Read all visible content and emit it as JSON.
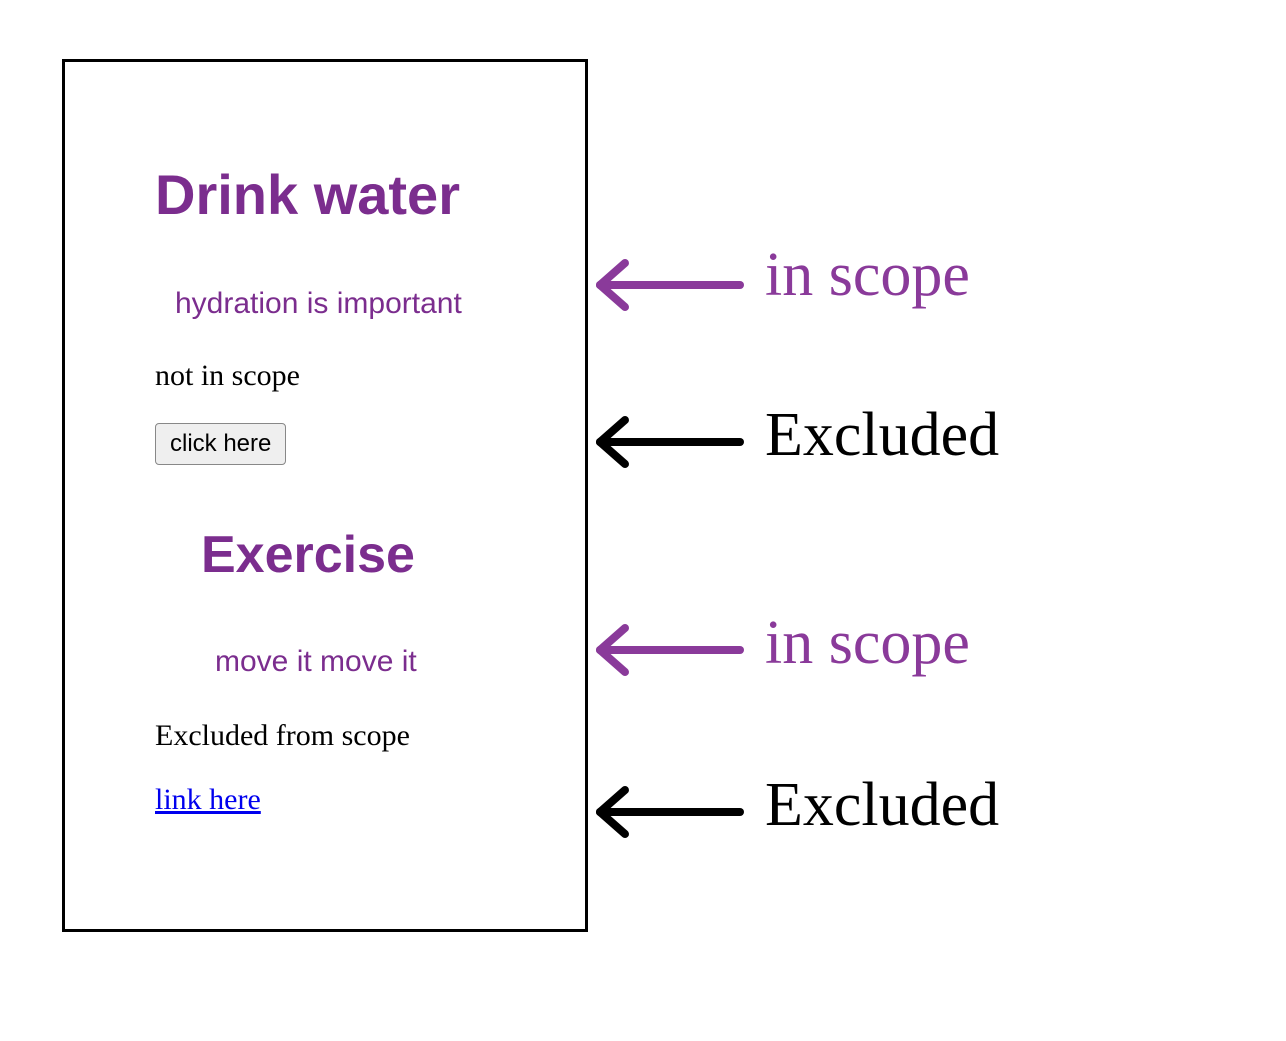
{
  "box": {
    "section1": {
      "heading": "Drink water",
      "subtext": "hydration is important",
      "plain": "not in scope",
      "button": "click here"
    },
    "section2": {
      "heading": "Exercise",
      "subtext": "move it move it",
      "plain": "Excluded from scope",
      "link": "link here"
    }
  },
  "annotations": {
    "inScope1": "in scope",
    "excluded1": "Excluded",
    "inScope2": "in scope",
    "excluded2": "Excluded"
  },
  "colors": {
    "purple": "#8a3a9a",
    "headingPurple": "#7b2d8e",
    "black": "#000000",
    "link": "#0000ee"
  }
}
